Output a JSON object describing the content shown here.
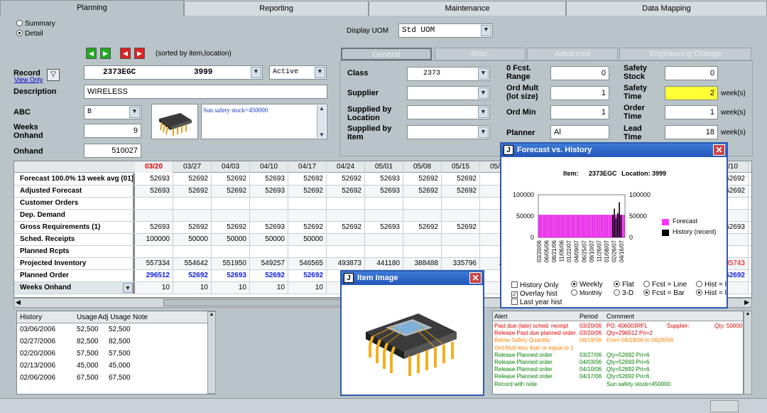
{
  "tabs": [
    {
      "label": "Planning",
      "active": true
    },
    {
      "label": "Reporting",
      "active": false
    },
    {
      "label": "Maintenance",
      "active": false
    },
    {
      "label": "Data Mapping",
      "active": false
    }
  ],
  "view_mode": {
    "summary": "Summary",
    "detail": "Detail",
    "selected": "Detail"
  },
  "display_uom": {
    "label": "Display UOM",
    "value": "Std UOM"
  },
  "nav": {
    "sorted_label": "(sorted by item,location)"
  },
  "record": {
    "label": "Record",
    "view_only": "View Only",
    "item": "2373EGC",
    "location": "3999",
    "status": "Active",
    "description_label": "Description",
    "description": "WIRELESS",
    "abc_label": "ABC",
    "abc": "B",
    "weeks_onhand_label": "Weeks Onhand",
    "weeks_onhand": "9",
    "onhand_label": "Onhand",
    "onhand": "510027",
    "note": "Sun safety stock=450000"
  },
  "subtabs": [
    {
      "label": "General",
      "active": true
    },
    {
      "label": "Misc.",
      "active": false
    },
    {
      "label": "Advanced",
      "active": false
    },
    {
      "label": "Engineering Change",
      "active": false
    }
  ],
  "general": {
    "class_label": "Class",
    "class": "2373",
    "supplier_label": "Supplier",
    "supplier": "",
    "supplied_by_location_label": "Supplied by Location",
    "supplied_by_location": "",
    "supplied_by_item_label": "Supplied by Item",
    "supplied_by_item": "",
    "fcst_range_label": "0 Fcst. Range",
    "fcst_range": "0",
    "ord_mult_label": "Ord Mult (lot size)",
    "ord_mult": "1",
    "ord_min_label": "Ord Min",
    "ord_min": "1",
    "planner_label": "Planner",
    "planner": "Al",
    "safety_stock_label": "Safety Stock",
    "safety_stock": "0",
    "safety_time_label": "Safety Time",
    "safety_time": "2",
    "order_time_label": "Order Time",
    "order_time": "1",
    "lead_time_label": "Lead Time",
    "lead_time": "18",
    "weeks_unit": "week(s)"
  },
  "grid": {
    "periods": [
      "03/20",
      "03/27",
      "04/03",
      "04/10",
      "04/17",
      "04/24",
      "05/01",
      "05/08",
      "05/15",
      "05/22",
      "",
      "",
      "",
      "",
      "",
      "07/10"
    ],
    "rows": [
      {
        "label": "Forecast 100.0% 13 week avg (01)",
        "values": [
          "52693",
          "52692",
          "52692",
          "52693",
          "52692",
          "52692",
          "52693",
          "52692",
          "52692",
          "526",
          "",
          "",
          "",
          "",
          "",
          "52692"
        ],
        "style": "normal"
      },
      {
        "label": "Adjusted Forecast",
        "values": [
          "52693",
          "52692",
          "52692",
          "52693",
          "52692",
          "52692",
          "52693",
          "52692",
          "52692",
          "526",
          "",
          "",
          "",
          "",
          "",
          "52692"
        ],
        "style": "normal"
      },
      {
        "label": "Customer Orders",
        "values": [
          "",
          "",
          "",
          "",
          "",
          "",
          "",
          "",
          "",
          "",
          "",
          "",
          "",
          "",
          "",
          ""
        ],
        "style": "normal"
      },
      {
        "label": "Dep. Demand",
        "values": [
          "",
          "",
          "",
          "",
          "",
          "",
          "",
          "",
          "",
          "",
          "",
          "",
          "",
          "",
          "",
          ""
        ],
        "style": "normal"
      },
      {
        "label": "Gross Requirements (1)",
        "values": [
          "52693",
          "52692",
          "52692",
          "52693",
          "52692",
          "52692",
          "52693",
          "52692",
          "52692",
          "526",
          "",
          "",
          "",
          "",
          "",
          "52693"
        ],
        "style": "normal"
      },
      {
        "label": "Sched. Receipts",
        "values": [
          "100000",
          "50000",
          "50000",
          "50000",
          "50000",
          "",
          "",
          "",
          "",
          "",
          "",
          "",
          "",
          "",
          "",
          ""
        ],
        "style": "normal"
      },
      {
        "label": "Planned Rcpts",
        "values": [
          "",
          "",
          "",
          "",
          "",
          "",
          "",
          "",
          "",
          "",
          "",
          "",
          "",
          "",
          "",
          ""
        ],
        "style": "normal"
      },
      {
        "label": "Projected Inventory",
        "values": [
          "557334",
          "554642",
          "551950",
          "549257",
          "546565",
          "493873",
          "441180",
          "388488",
          "335796",
          "2831",
          "",
          "",
          "",
          "",
          "",
          "85743"
        ],
        "style": "projected"
      },
      {
        "label": "Planned Order",
        "values": [
          "296512",
          "52692",
          "52693",
          "52692",
          "52692",
          "52692",
          "52693",
          "52692",
          "52692",
          "526",
          "",
          "",
          "",
          "",
          "",
          "52692"
        ],
        "style": "planned"
      },
      {
        "label": "Weeks Onhand",
        "values": [
          "10",
          "10",
          "10",
          "10",
          "10",
          "10",
          "10",
          "10",
          "10",
          "",
          "",
          "",
          "",
          "",
          "",
          ""
        ],
        "style": "normal"
      }
    ],
    "watermark": "download"
  },
  "history": {
    "headers": [
      "History",
      "Usage",
      "Adj Usage",
      "Note"
    ],
    "rows": [
      {
        "date": "03/06/2006",
        "usage": "52,500",
        "adj": "52,500"
      },
      {
        "date": "02/27/2006",
        "usage": "82,500",
        "adj": "82,500"
      },
      {
        "date": "02/20/2006",
        "usage": "57,500",
        "adj": "57,500"
      },
      {
        "date": "02/13/2006",
        "usage": "45,000",
        "adj": "45,000"
      },
      {
        "date": "02/06/2006",
        "usage": "67,500",
        "adj": "67,500"
      }
    ]
  },
  "item_image_window": {
    "title": "Item Image"
  },
  "forecast_window": {
    "title": "Forecast vs. History",
    "item_label": "Item:",
    "item": "2373EGC",
    "location_label": "Location:",
    "location": "3999",
    "legend_forecast": "Forecast",
    "legend_history": "History (recent)",
    "options": {
      "history_only": "History Only",
      "overlay_hist": "Overlay hist",
      "last_year_hist": "Last year hist",
      "weekly": "Weekly",
      "monthly": "Monthly",
      "flat": "Flat",
      "three_d": "3-D",
      "fcst_line": "Fcst = Line",
      "fcst_bar": "Fcst = Bar",
      "hist_1": "Hist = l",
      "hist_2": "Hist = l"
    }
  },
  "chart_data": {
    "type": "bar",
    "yticks": [
      "100000",
      "50000",
      "0"
    ],
    "ylim": [
      0,
      100000
    ],
    "xticks": [
      "03/20/06",
      "06/05/06",
      "08/21/06",
      "11/06/06",
      "01/22/07",
      "04/09/07",
      "06/25/07",
      "09/10/07",
      "11/26/07",
      "01/08/07",
      "02/26/07",
      "04/16/07"
    ],
    "series": [
      {
        "name": "Forecast",
        "color": "#ff33ff",
        "value": 52692,
        "count": 52
      },
      {
        "name": "History (recent)",
        "color": "#000000",
        "values": [
          52500,
          67500,
          45000,
          57500,
          82500,
          52500
        ]
      }
    ]
  },
  "alerts": {
    "headers": [
      "Alert",
      "Period",
      "Comment"
    ],
    "rows": [
      {
        "alert": "Past due (late) sched. receipt",
        "period": "03/20/06",
        "comment": "PO: 406003RFL",
        "supplier": "Supplier:",
        "qty": "Qty: 50000",
        "color": "#e00000"
      },
      {
        "alert": "Release Past due planned order",
        "period": "03/20/06",
        "comment": "Qty=296512  Pri=2",
        "supplier": "",
        "qty": "",
        "color": "#e00000"
      },
      {
        "alert": "Below Safety Quantity",
        "period": "06/19/06",
        "comment": "From 06/19/06 to 06/26/06",
        "supplier": "",
        "qty": "",
        "color": "#ff8000"
      },
      {
        "alert": "Ord Mult less than or equal to 1",
        "period": "",
        "comment": "",
        "supplier": "",
        "qty": "",
        "color": "#ff8000"
      },
      {
        "alert": "Release Planned order",
        "period": "03/27/06",
        "comment": "Qty=52692  Pri=6",
        "supplier": "",
        "qty": "",
        "color": "#008000"
      },
      {
        "alert": "Release Planned order",
        "period": "04/03/06",
        "comment": "Qty=52693  Pri=6",
        "supplier": "",
        "qty": "",
        "color": "#008000"
      },
      {
        "alert": "Release Planned order",
        "period": "04/10/06",
        "comment": "Qty=52692  Pri=6",
        "supplier": "",
        "qty": "",
        "color": "#008000"
      },
      {
        "alert": "Release Planned order",
        "period": "04/17/06",
        "comment": "Qty=52692  Pri=6",
        "supplier": "",
        "qty": "",
        "color": "#008000"
      },
      {
        "alert": "Record with note",
        "period": "",
        "comment": "Sun safety stock=450000",
        "supplier": "",
        "qty": "",
        "color": "#008000"
      }
    ]
  }
}
